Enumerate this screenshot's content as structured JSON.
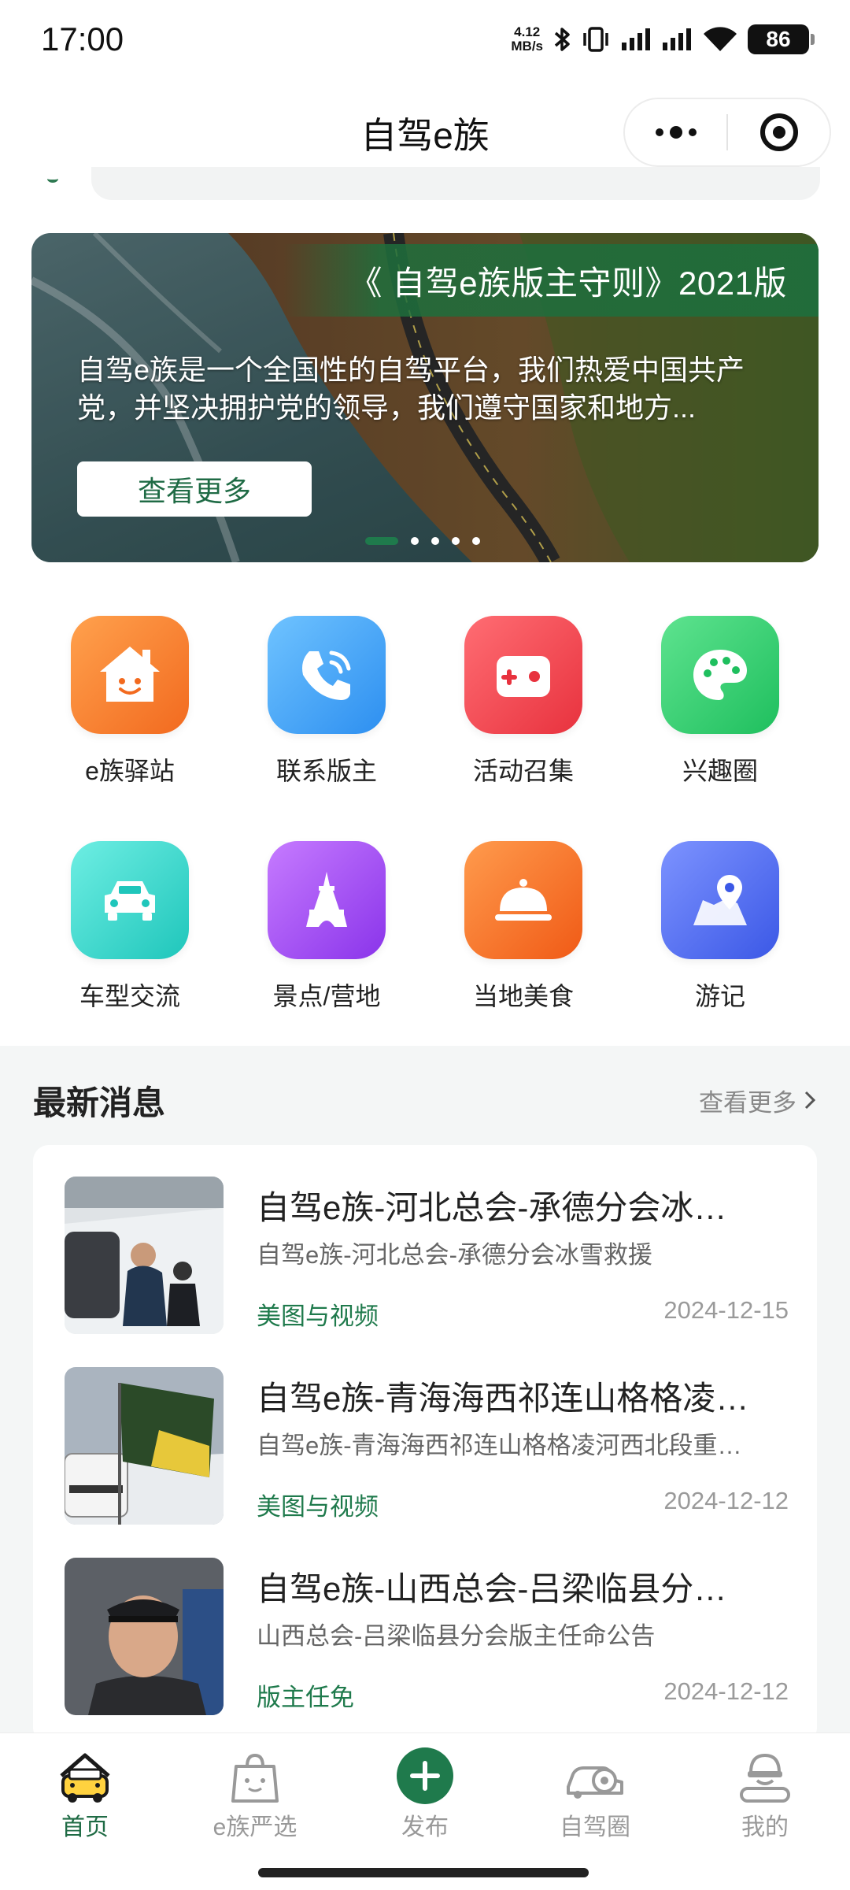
{
  "status_bar": {
    "time": "17:00",
    "net_speed_value": "4.12",
    "net_speed_unit": "MB/s",
    "battery": "86",
    "icons": [
      "bluetooth-icon",
      "vibrate-icon",
      "signal-icon",
      "signal-icon",
      "wifi-icon",
      "battery-icon"
    ]
  },
  "nav": {
    "title": "自驾e族",
    "more_icon": "more-dots-icon",
    "close_icon": "target-icon"
  },
  "banner": {
    "title": "《 自驾e族版主守则》2021版",
    "description": "自驾e族是一个全国性的自驾平台，我们热爱中国共产党，并坚决拥护党的领导，我们遵守国家和地方...",
    "button_label": "查看更多",
    "slide_count": 5,
    "active_slide": 1
  },
  "grid": {
    "items": [
      {
        "label": "e族驿站",
        "icon": "house-face-icon",
        "color": "#f5742c"
      },
      {
        "label": "联系版主",
        "icon": "phone-icon",
        "color": "#3fa3f3"
      },
      {
        "label": "活动召集",
        "icon": "gamepad-icon",
        "color": "#f2454f"
      },
      {
        "label": "兴趣圈",
        "icon": "palette-icon",
        "color": "#2dc86a"
      },
      {
        "label": "车型交流",
        "icon": "car-icon",
        "color": "#2bcfc4"
      },
      {
        "label": "景点/营地",
        "icon": "tower-icon",
        "color": "#a14cf0"
      },
      {
        "label": "当地美食",
        "icon": "cloche-icon",
        "color": "#f56d24"
      },
      {
        "label": "游记",
        "icon": "map-pin-icon",
        "color": "#4a6af0"
      }
    ]
  },
  "news": {
    "title": "最新消息",
    "more_label": "查看更多",
    "items": [
      {
        "headline": "自驾e族-河北总会-承德分会冰…",
        "subtitle": "自驾e族-河北总会-承德分会冰雪救援",
        "category": "美图与视频",
        "date": "2024-12-15"
      },
      {
        "headline": "自驾e族-青海海西祁连山格格凌…",
        "subtitle": "自驾e族-青海海西祁连山格格凌河西北段重…",
        "category": "美图与视频",
        "date": "2024-12-12"
      },
      {
        "headline": "自驾e族-山西总会-吕梁临县分…",
        "subtitle": "山西总会-吕梁临县分会版主任命公告",
        "category": "版主任免",
        "date": "2024-12-12"
      }
    ]
  },
  "tabs": [
    {
      "label": "首页",
      "icon": "car-front-icon",
      "active": true
    },
    {
      "label": "e族严选",
      "icon": "shopping-bag-icon",
      "active": false
    },
    {
      "label": "发布",
      "icon": "plus-icon",
      "active": false
    },
    {
      "label": "自驾圈",
      "icon": "car-camera-icon",
      "active": false
    },
    {
      "label": "我的",
      "icon": "helmet-person-icon",
      "active": false
    }
  ],
  "colors": {
    "brand_green": "#1f6b45",
    "accent_green": "#1f7a4c"
  }
}
